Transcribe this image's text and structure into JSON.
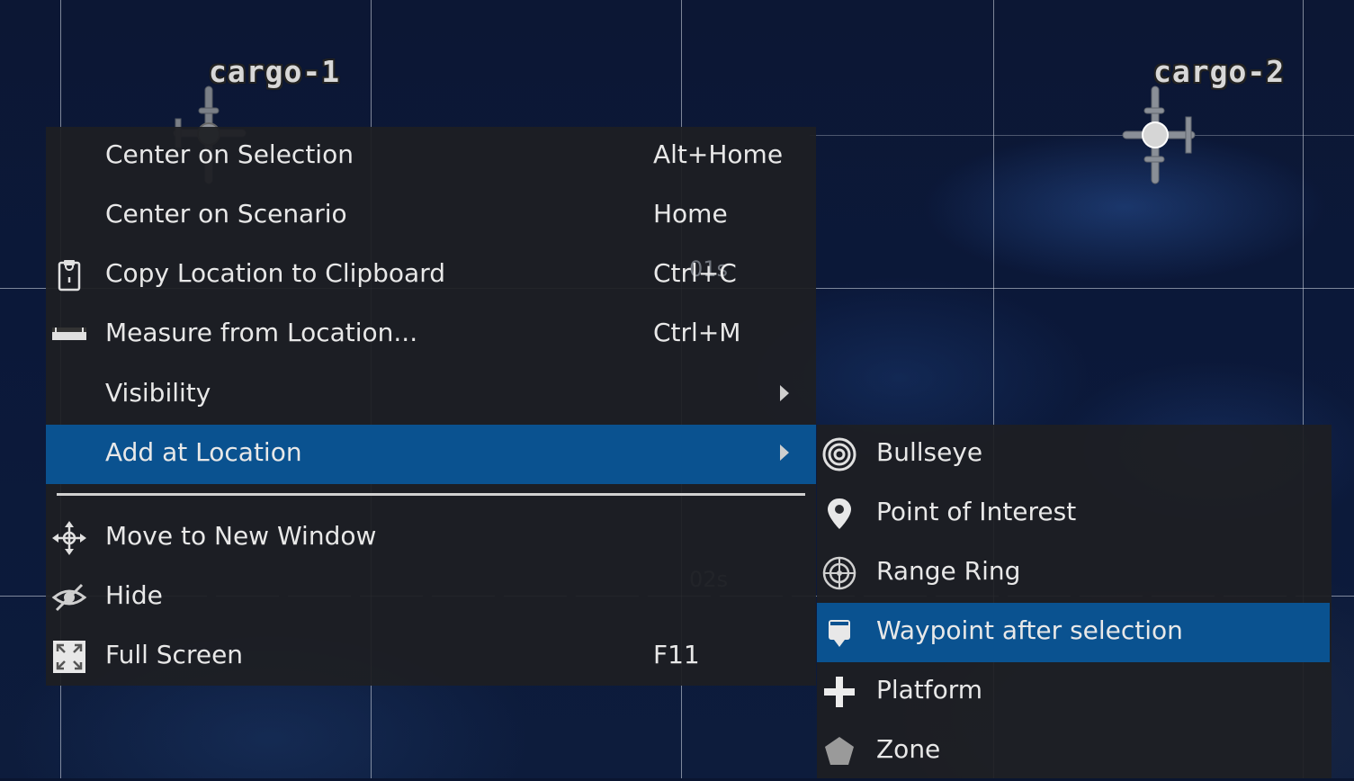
{
  "map": {
    "units": [
      {
        "label": "cargo-1"
      },
      {
        "label": "cargo-2"
      }
    ],
    "time_labels": [
      "01s",
      "02s"
    ]
  },
  "context_menu": {
    "items": [
      {
        "label": "Center on Selection",
        "shortcut": "Alt+Home",
        "icon": ""
      },
      {
        "label": "Center on Scenario",
        "shortcut": "Home",
        "icon": ""
      },
      {
        "label": "Copy Location to Clipboard",
        "shortcut": "Ctrl+C",
        "icon": "clipboard-icon"
      },
      {
        "label": "Measure from Location...",
        "shortcut": "Ctrl+M",
        "icon": "ruler-icon"
      },
      {
        "label": "Visibility",
        "shortcut": "",
        "icon": "",
        "submenu": true
      },
      {
        "label": "Add at Location",
        "shortcut": "",
        "icon": "",
        "submenu": true,
        "highlighted": true
      },
      {
        "label": "Move to New Window",
        "shortcut": "",
        "icon": "move-icon"
      },
      {
        "label": "Hide",
        "shortcut": "",
        "icon": "hide-eye-icon"
      },
      {
        "label": "Full Screen",
        "shortcut": "F11",
        "icon": "fullscreen-icon"
      }
    ]
  },
  "add_submenu": {
    "items": [
      {
        "label": "Bullseye",
        "icon": "bullseye-icon"
      },
      {
        "label": "Point of Interest",
        "icon": "map-pin-icon"
      },
      {
        "label": "Range Ring",
        "icon": "range-ring-icon"
      },
      {
        "label": "Waypoint after selection",
        "icon": "waypoint-icon",
        "highlighted": true
      },
      {
        "label": "Platform",
        "icon": "plus-icon"
      },
      {
        "label": "Zone",
        "icon": "pentagon-icon"
      }
    ]
  },
  "colors": {
    "menu_background": "#1e1f23",
    "highlight": "#0a5290",
    "map_background": "#0b1839"
  }
}
